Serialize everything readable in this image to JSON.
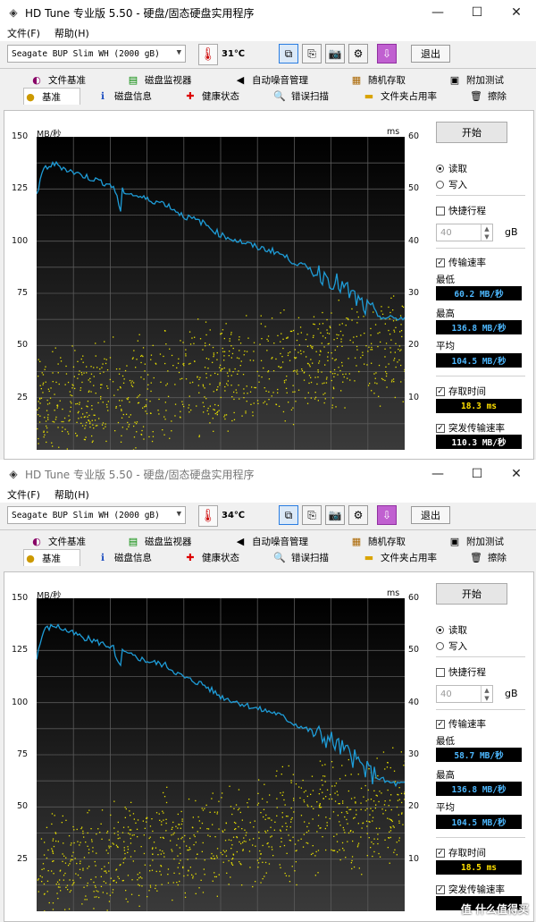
{
  "windows": [
    {
      "title": "HD Tune 专业版 5.50 - 硬盘/固态硬盘实用程序",
      "menu": [
        "文件(F)",
        "帮助(H)"
      ],
      "drive": "Seagate BUP Slim WH (2000 gB)",
      "temperature": "31℃",
      "exit_label": "退出",
      "tabs_top": [
        "文件基准",
        "磁盘监视器",
        "自动噪音管理",
        "随机存取",
        "附加测试"
      ],
      "tabs_bottom": [
        "基准",
        "磁盘信息",
        "健康状态",
        "错误扫描",
        "文件夹占用率",
        "擦除"
      ],
      "start_label": "开始",
      "radio_read": "读取",
      "radio_write": "写入",
      "quick_stroke": "快捷行程",
      "stroke_value": "40",
      "stroke_unit": "gB",
      "transfer_rate": "传输速率",
      "min_label": "最低",
      "min_value": "60.2 MB/秒",
      "max_label": "最高",
      "max_value": "136.8 MB/秒",
      "avg_label": "平均",
      "avg_value": "104.5 MB/秒",
      "access_time_label": "存取时间",
      "access_time_value": "18.3 ms",
      "burst_label": "突发传输速率",
      "burst_value": "110.3 MB/秒",
      "y_left_unit": "MB/秒",
      "y_right_unit": "ms",
      "y_left_ticks": [
        "150",
        "125",
        "100",
        "75",
        "50",
        "25"
      ],
      "y_right_ticks": [
        "60",
        "50",
        "40",
        "30",
        "20",
        "10"
      ]
    },
    {
      "title": "HD Tune 专业版 5.50 - 硬盘/固态硬盘实用程序",
      "menu": [
        "文件(F)",
        "帮助(H)"
      ],
      "drive": "Seagate BUP Slim WH (2000 gB)",
      "temperature": "34℃",
      "exit_label": "退出",
      "tabs_top": [
        "文件基准",
        "磁盘监视器",
        "自动噪音管理",
        "随机存取",
        "附加测试"
      ],
      "tabs_bottom": [
        "基准",
        "磁盘信息",
        "健康状态",
        "错误扫描",
        "文件夹占用率",
        "擦除"
      ],
      "start_label": "开始",
      "radio_read": "读取",
      "radio_write": "写入",
      "quick_stroke": "快捷行程",
      "stroke_value": "40",
      "stroke_unit": "gB",
      "transfer_rate": "传输速率",
      "min_label": "最低",
      "min_value": "58.7 MB/秒",
      "max_label": "最高",
      "max_value": "136.8 MB/秒",
      "avg_label": "平均",
      "avg_value": "104.5 MB/秒",
      "access_time_label": "存取时间",
      "access_time_value": "18.5 ms",
      "burst_label": "突发传输速率",
      "burst_value": "",
      "y_left_unit": "MB/秒",
      "y_right_unit": "ms",
      "y_left_ticks": [
        "150",
        "125",
        "100",
        "75",
        "50",
        "25"
      ],
      "y_right_ticks": [
        "60",
        "50",
        "40",
        "30",
        "20",
        "10"
      ]
    }
  ],
  "chart_data": [
    {
      "type": "line",
      "ylim": [
        0,
        150
      ],
      "y2lim": [
        0,
        60
      ],
      "series": [
        {
          "x": [
            0,
            2,
            5,
            10,
            15,
            20,
            25,
            30,
            35,
            40,
            45,
            50,
            55,
            60,
            65,
            70,
            75,
            80,
            85,
            88,
            90,
            92,
            95,
            98,
            100
          ],
          "values": [
            122,
            135,
            137,
            133,
            130,
            127,
            123,
            120,
            118,
            112,
            109,
            103,
            100,
            97,
            95,
            90,
            86,
            82,
            75,
            70,
            67,
            65,
            63,
            63,
            63
          ]
        }
      ],
      "scatter_ms_range": [
        5,
        25
      ]
    },
    {
      "type": "line",
      "ylim": [
        0,
        150
      ],
      "y2lim": [
        0,
        60
      ],
      "series": [
        {
          "x": [
            0,
            2,
            5,
            10,
            15,
            20,
            25,
            30,
            35,
            40,
            45,
            50,
            55,
            60,
            65,
            70,
            75,
            80,
            85,
            88,
            90,
            92,
            95,
            98,
            100
          ],
          "values": [
            122,
            135,
            137,
            133,
            130,
            127,
            123,
            120,
            118,
            112,
            109,
            103,
            100,
            97,
            95,
            90,
            86,
            82,
            75,
            70,
            67,
            65,
            62,
            61,
            61
          ]
        }
      ],
      "scatter_ms_range": [
        5,
        25
      ]
    }
  ],
  "watermark": "值 什么值得买"
}
